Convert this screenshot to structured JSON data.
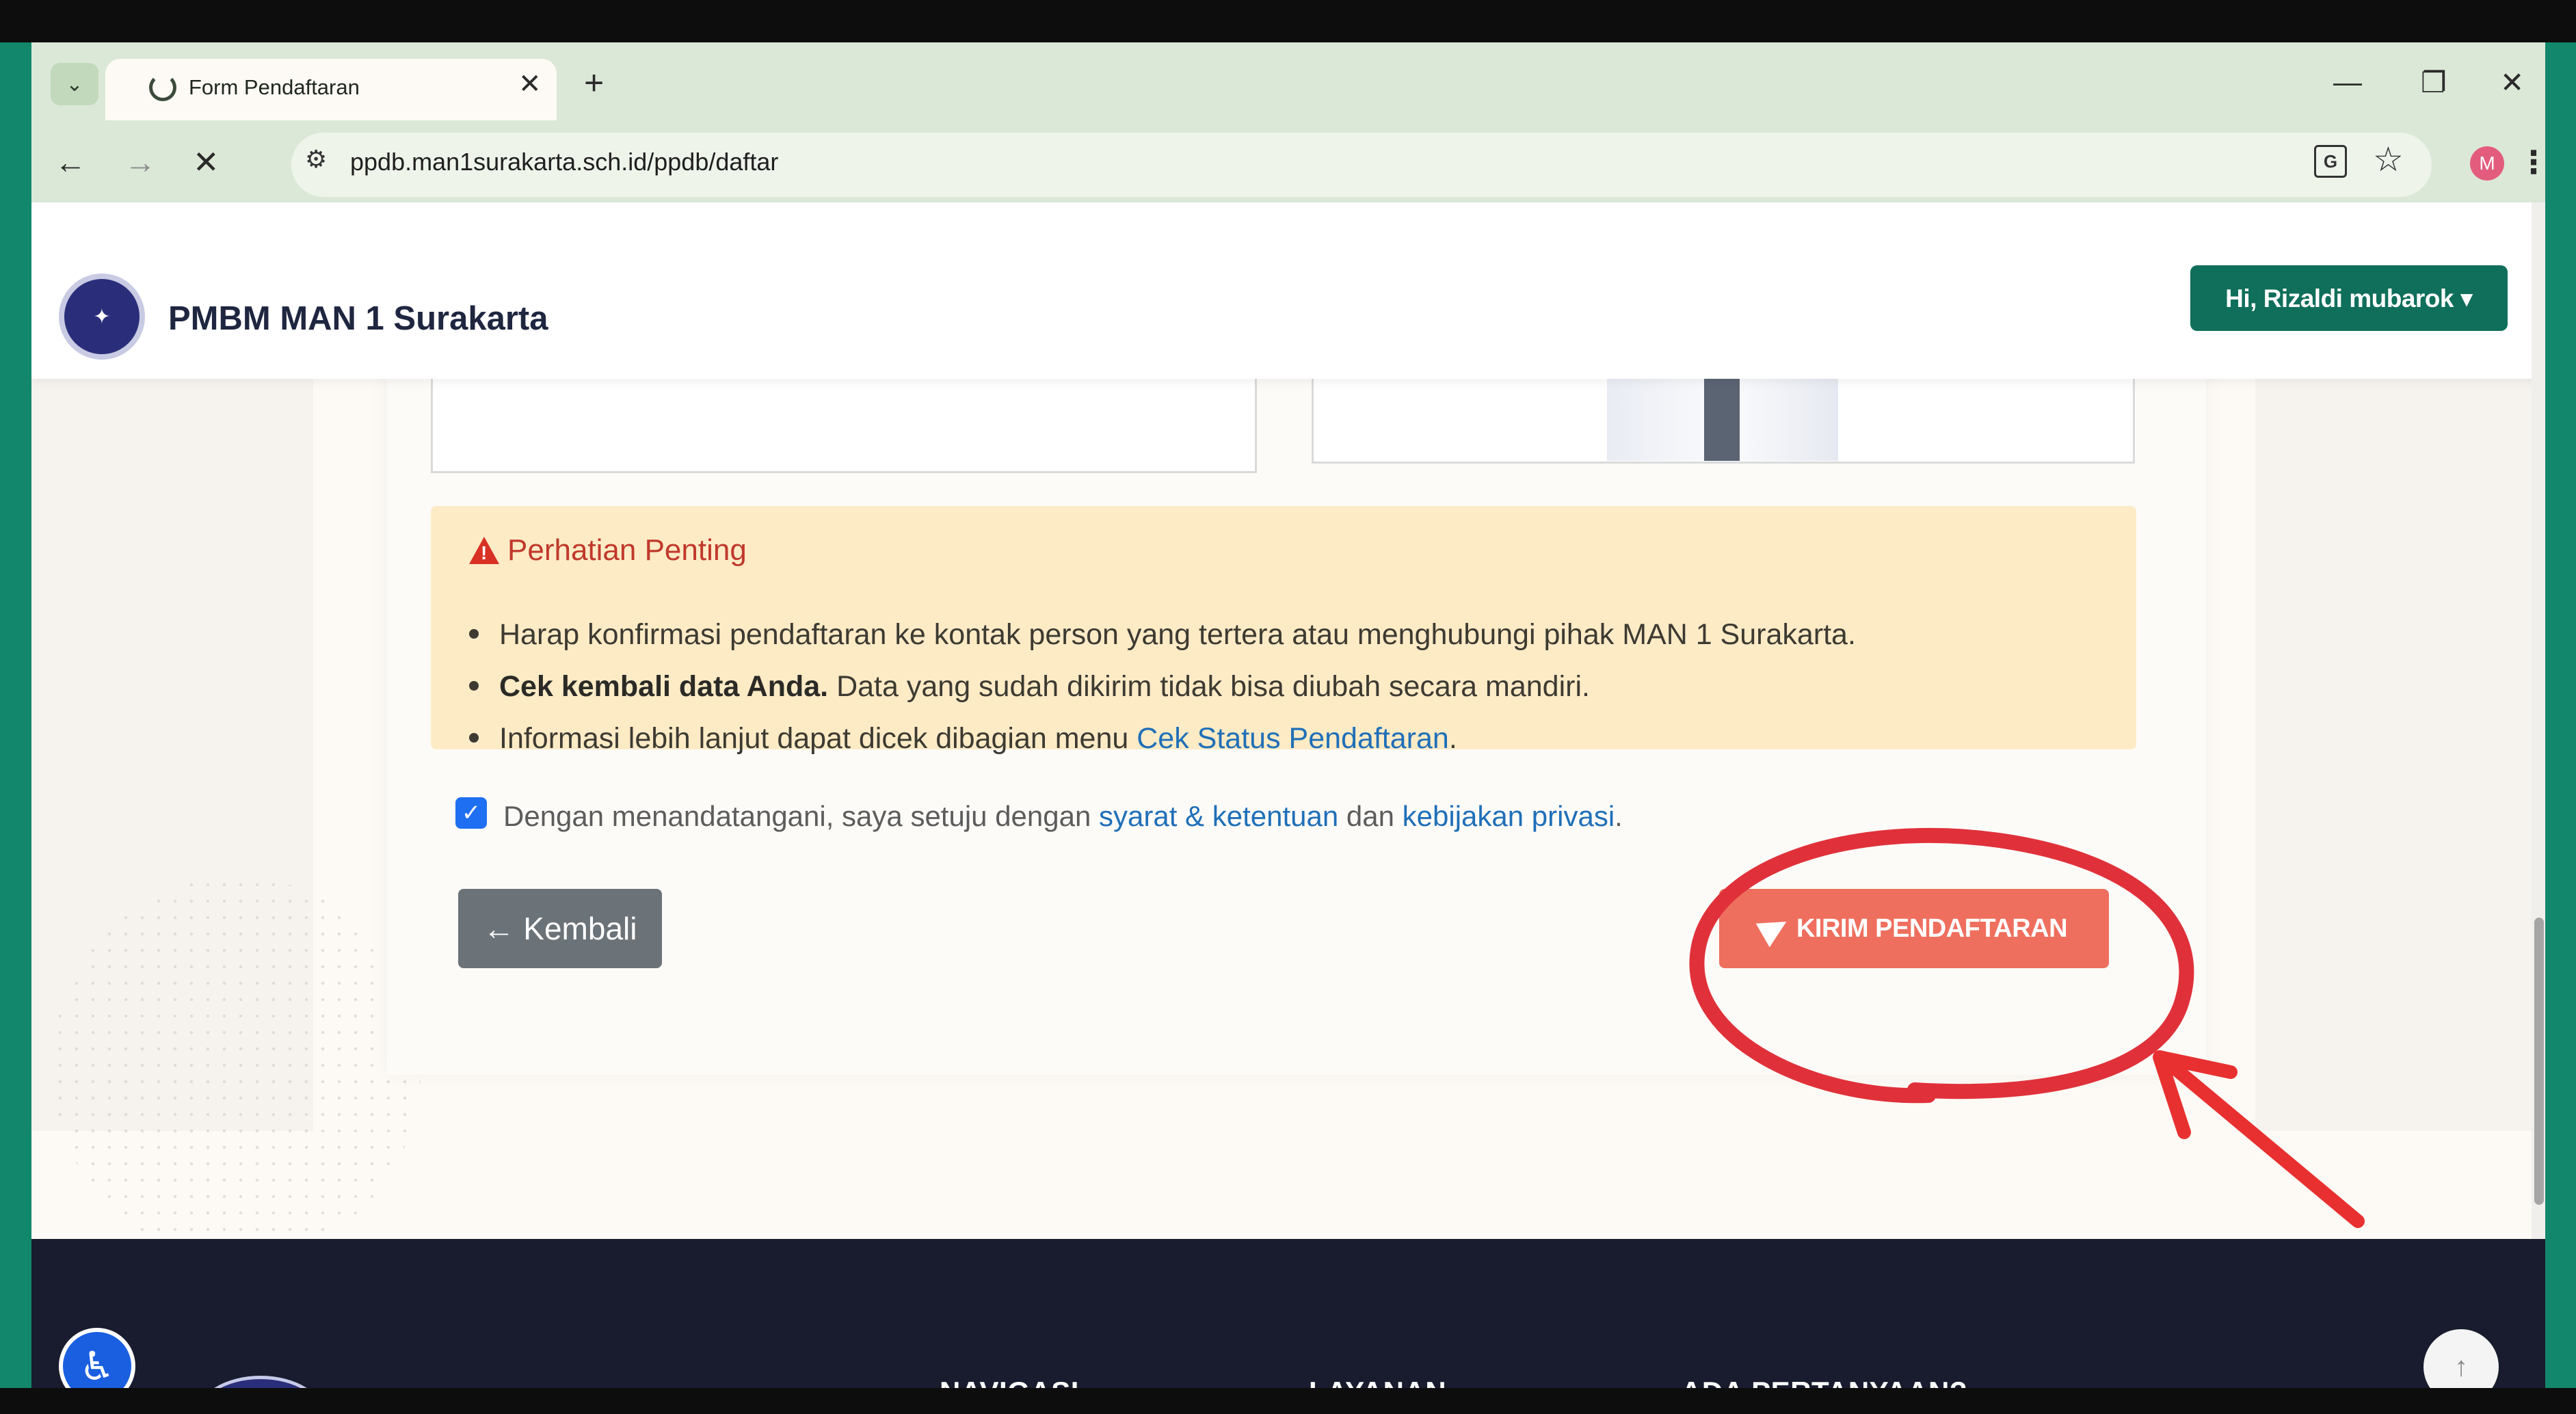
{
  "browser": {
    "tab_title": "Form Pendaftaran",
    "url": "ppdb.man1surakarta.sch.id/ppdb/daftar",
    "avatar_initial": "M",
    "icons": [
      "tab-list-icon",
      "spinner-icon",
      "close-icon",
      "plus-icon",
      "minimize-icon",
      "restore-icon",
      "back-arrow-icon",
      "forward-arrow-icon",
      "stop-icon",
      "site-info-icon",
      "translate-icon",
      "star-icon",
      "kebab-menu-icon"
    ]
  },
  "header": {
    "brand": "PMBM MAN 1 Surakarta",
    "user_menu": "Hi, Rizaldi mubarok ▾"
  },
  "alert": {
    "title": "Perhatian Penting",
    "item1": "Harap konfirmasi pendaftaran ke kontak person yang tertera atau menghubungi pihak MAN 1 Surakarta.",
    "item2_bold": "Cek kembali data Anda.",
    "item2_rest": " Data yang sudah dikirim tidak bisa diubah secara mandiri.",
    "item3_text": "Informasi lebih lanjut dapat dicek dibagian menu ",
    "item3_link": "Cek Status Pendaftaran",
    "item3_end": "."
  },
  "agreement": {
    "text1": "Dengan menandatangani, saya setuju dengan ",
    "link1": "syarat & ketentuan",
    "text2": " dan ",
    "link2": "kebijakan privasi",
    "text3": ".",
    "checked": true
  },
  "buttons": {
    "back": "← Kembali",
    "submit": "KIRIM PENDAFTARAN"
  },
  "footer": {
    "nav_heading": "NAVIGASI",
    "services_heading": "LAYANAN",
    "questions_heading": "ADA PERTANYAAN?"
  },
  "colors": {
    "frame": "#13876b",
    "brand_green": "#0f6f5a",
    "submit": "#ef6f5e",
    "annotation": "#e0313a"
  }
}
